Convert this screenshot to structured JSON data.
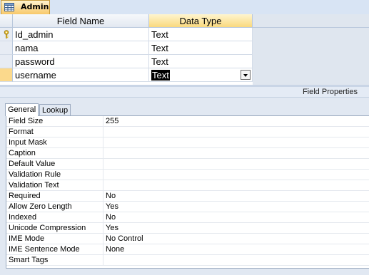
{
  "tab": {
    "label": "Admin",
    "icon": "table-icon"
  },
  "grid": {
    "headers": {
      "field_name": "Field Name",
      "data_type": "Data Type"
    },
    "rows": [
      {
        "field": "Id_admin",
        "type": "Text",
        "primary_key": true
      },
      {
        "field": "nama",
        "type": "Text"
      },
      {
        "field": "password",
        "type": "Text"
      },
      {
        "field": "username",
        "type": "Text",
        "current": true
      }
    ]
  },
  "field_properties": {
    "title": "Field Properties",
    "tabs": [
      "General",
      "Lookup"
    ],
    "active_tab": "General",
    "properties": [
      {
        "name": "Field Size",
        "value": "255"
      },
      {
        "name": "Format",
        "value": ""
      },
      {
        "name": "Input Mask",
        "value": ""
      },
      {
        "name": "Caption",
        "value": ""
      },
      {
        "name": "Default Value",
        "value": ""
      },
      {
        "name": "Validation Rule",
        "value": ""
      },
      {
        "name": "Validation Text",
        "value": ""
      },
      {
        "name": "Required",
        "value": "No"
      },
      {
        "name": "Allow Zero Length",
        "value": "Yes"
      },
      {
        "name": "Indexed",
        "value": "No"
      },
      {
        "name": "Unicode Compression",
        "value": "Yes"
      },
      {
        "name": "IME Mode",
        "value": "No Control"
      },
      {
        "name": "IME Sentence Mode",
        "value": "None"
      },
      {
        "name": "Smart Tags",
        "value": ""
      }
    ]
  },
  "colors": {
    "accent": "#fbd98c",
    "header_bg": "#e2e8f1",
    "pane_bg": "#e1e8f2"
  }
}
